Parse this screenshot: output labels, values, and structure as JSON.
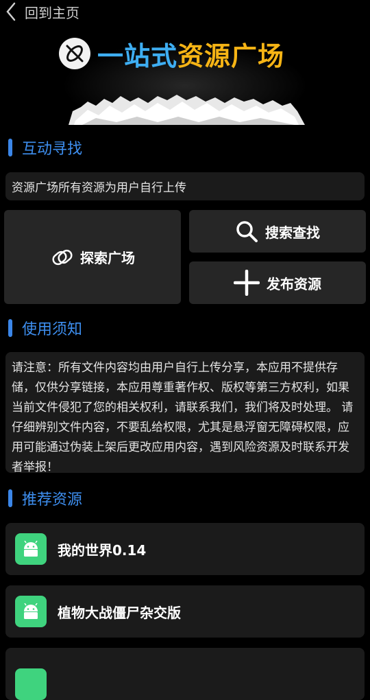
{
  "topbar": {
    "back_label": "回到主页"
  },
  "banner": {
    "title_part1": "一站式",
    "title_part2": "资源广场",
    "colors": {
      "part1": "#3eaef2",
      "part2": "#f6b415"
    }
  },
  "interaction": {
    "section_title": "互动寻找",
    "info_text": "资源广场所有资源为用户自行上传",
    "explore_label": "探索广场",
    "search_label": "搜索查找",
    "publish_label": "发布资源"
  },
  "notice": {
    "section_title": "使用须知",
    "text": "请注意：所有文件内容均由用户自行上传分享，本应用不提供存储，仅供分享链接，本应用尊重著作权、版权等第三方权利，如果当前文件侵犯了您的相关权利，请联系我们，我们将及时处理。 请仔细辨别文件内容，不要乱给权限，尤其是悬浮窗无障碍权限，应用可能通过伪装上架后更改应用内容，遇到风险资源及时联系开发者举报！"
  },
  "recommend": {
    "section_title": "推荐资源",
    "items": [
      {
        "name": "我的世界0.14",
        "icon": "android-icon"
      },
      {
        "name": "植物大战僵尸杂交版",
        "icon": "android-icon"
      },
      {
        "name": "",
        "icon": "android-icon"
      }
    ]
  },
  "accent_color": "#3b86e8",
  "app_icon_color": "#3fd37e"
}
